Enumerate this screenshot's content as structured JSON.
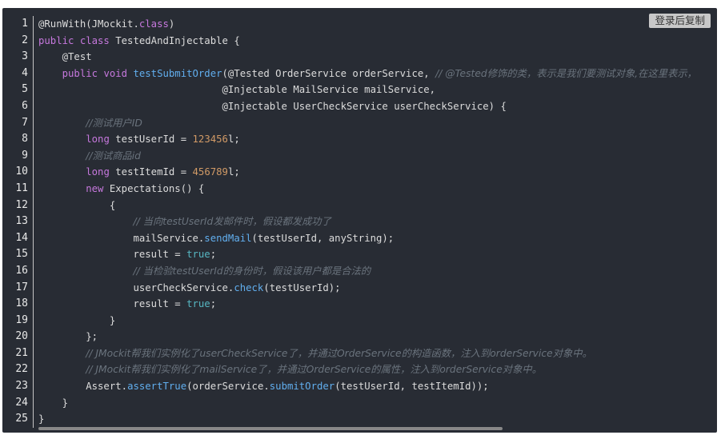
{
  "toolbar": {
    "copy_label": "登录后复制"
  },
  "colors": {
    "background": "#282c34",
    "keyword": "#c678dd",
    "function": "#61aeee",
    "number": "#d19a66",
    "literal": "#56b6c2",
    "comment": "#6a737d",
    "plain": "#dcdcdc"
  },
  "code": {
    "line_numbers": [
      "1",
      "2",
      "3",
      "4",
      "5",
      "6",
      "7",
      "8",
      "9",
      "10",
      "11",
      "12",
      "13",
      "14",
      "15",
      "16",
      "17",
      "18",
      "19",
      "20",
      "21",
      "22",
      "23",
      "24",
      "25"
    ],
    "lines": [
      [
        [
          "ann",
          "@RunWith(JMockit."
        ],
        [
          "kw",
          "class"
        ],
        [
          "plain",
          ")"
        ]
      ],
      [
        [
          "kw",
          "public class "
        ],
        [
          "plain",
          "TestedAndInjectable {"
        ]
      ],
      [
        [
          "plain",
          "    @Test"
        ]
      ],
      [
        [
          "plain",
          "    "
        ],
        [
          "kw",
          "public void "
        ],
        [
          "fn",
          "testSubmitOrder"
        ],
        [
          "plain",
          "(@Tested OrderService orderService, "
        ],
        [
          "cmt",
          "// @Tested修饰的类，表示是我们要测试对象,在这里表示，"
        ]
      ],
      [
        [
          "plain",
          "                               @Injectable MailService mailService,"
        ]
      ],
      [
        [
          "plain",
          "                               @Injectable UserCheckService userCheckService) {"
        ]
      ],
      [
        [
          "plain",
          "        "
        ],
        [
          "cmt",
          "//测试用户ID"
        ]
      ],
      [
        [
          "plain",
          "        "
        ],
        [
          "kw",
          "long "
        ],
        [
          "plain",
          "testUserId "
        ],
        [
          "op",
          "= "
        ],
        [
          "num",
          "123456"
        ],
        [
          "plain",
          "l;"
        ]
      ],
      [
        [
          "plain",
          "        "
        ],
        [
          "cmt",
          "//测试商品id"
        ]
      ],
      [
        [
          "plain",
          "        "
        ],
        [
          "kw",
          "long "
        ],
        [
          "plain",
          "testItemId "
        ],
        [
          "op",
          "= "
        ],
        [
          "num",
          "456789"
        ],
        [
          "plain",
          "l;"
        ]
      ],
      [
        [
          "plain",
          "        "
        ],
        [
          "kw",
          "new "
        ],
        [
          "plain",
          "Expectations() {"
        ]
      ],
      [
        [
          "plain",
          "            {"
        ]
      ],
      [
        [
          "plain",
          "                "
        ],
        [
          "cmt",
          "// 当向testUserId发邮件时，假设都发成功了"
        ]
      ],
      [
        [
          "plain",
          "                mailService."
        ],
        [
          "fn",
          "sendMail"
        ],
        [
          "plain",
          "(testUserId, anyString);"
        ]
      ],
      [
        [
          "plain",
          "                result "
        ],
        [
          "op",
          "= "
        ],
        [
          "lit",
          "true"
        ],
        [
          "plain",
          ";"
        ]
      ],
      [
        [
          "plain",
          "                "
        ],
        [
          "cmt",
          "// 当检验testUserId的身份时，假设该用户都是合法的"
        ]
      ],
      [
        [
          "plain",
          "                userCheckService."
        ],
        [
          "fn",
          "check"
        ],
        [
          "plain",
          "(testUserId);"
        ]
      ],
      [
        [
          "plain",
          "                result "
        ],
        [
          "op",
          "= "
        ],
        [
          "lit",
          "true"
        ],
        [
          "plain",
          ";"
        ]
      ],
      [
        [
          "plain",
          "            }"
        ]
      ],
      [
        [
          "plain",
          "        };"
        ]
      ],
      [
        [
          "plain",
          "        "
        ],
        [
          "cmt",
          "// JMockit帮我们实例化了userCheckService了，并通过OrderService的构造函数，注入到orderService对象中。"
        ]
      ],
      [
        [
          "plain",
          "        "
        ],
        [
          "cmt",
          "// JMockit帮我们实例化了mailService了，并通过OrderService的属性，注入到orderService对象中。"
        ]
      ],
      [
        [
          "plain",
          "        Assert."
        ],
        [
          "fn",
          "assertTrue"
        ],
        [
          "plain",
          "(orderService."
        ],
        [
          "fn",
          "submitOrder"
        ],
        [
          "plain",
          "(testUserId, testItemId));"
        ]
      ],
      [
        [
          "plain",
          "    }"
        ]
      ],
      [
        [
          "plain",
          "}"
        ]
      ]
    ]
  }
}
